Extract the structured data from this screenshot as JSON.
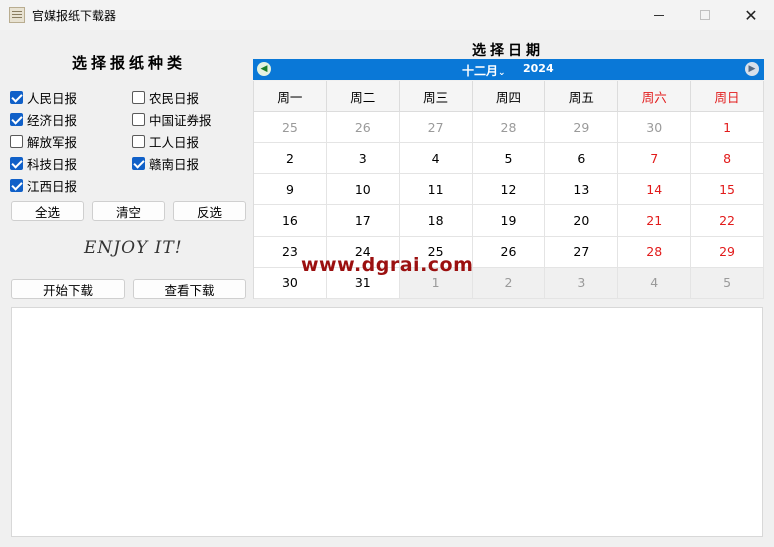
{
  "window": {
    "title": "官媒报纸下载器"
  },
  "left": {
    "title": "选择报纸种类",
    "papers": [
      {
        "label": "人民日报",
        "checked": true
      },
      {
        "label": "农民日报",
        "checked": false
      },
      {
        "label": "经济日报",
        "checked": true
      },
      {
        "label": "中国证券报",
        "checked": false
      },
      {
        "label": "解放军报",
        "checked": false
      },
      {
        "label": "工人日报",
        "checked": false
      },
      {
        "label": "科技日报",
        "checked": true
      },
      {
        "label": "赣南日报",
        "checked": true
      },
      {
        "label": "江西日报",
        "checked": true
      }
    ],
    "buttons": {
      "select_all": "全选",
      "clear": "清空",
      "invert": "反选"
    },
    "slogan": "ENJOY IT!",
    "start_download": "开始下载",
    "view_download": "查看下载"
  },
  "calendar": {
    "title": "选择日期",
    "month": "十二月",
    "year": "2024",
    "weekdays": [
      "周一",
      "周二",
      "周三",
      "周四",
      "周五",
      "周六",
      "周日"
    ],
    "days": [
      [
        "25",
        "26",
        "27",
        "28",
        "29",
        "30",
        "1"
      ],
      [
        "2",
        "3",
        "4",
        "5",
        "6",
        "7",
        "8"
      ],
      [
        "9",
        "10",
        "11",
        "12",
        "13",
        "14",
        "15"
      ],
      [
        "16",
        "17",
        "18",
        "19",
        "20",
        "21",
        "22"
      ],
      [
        "23",
        "24",
        "25",
        "26",
        "27",
        "28",
        "29"
      ],
      [
        "30",
        "31",
        "1",
        "2",
        "3",
        "4",
        "5"
      ]
    ]
  },
  "watermark": "www.dgrai.com",
  "log": {
    "text": ""
  }
}
